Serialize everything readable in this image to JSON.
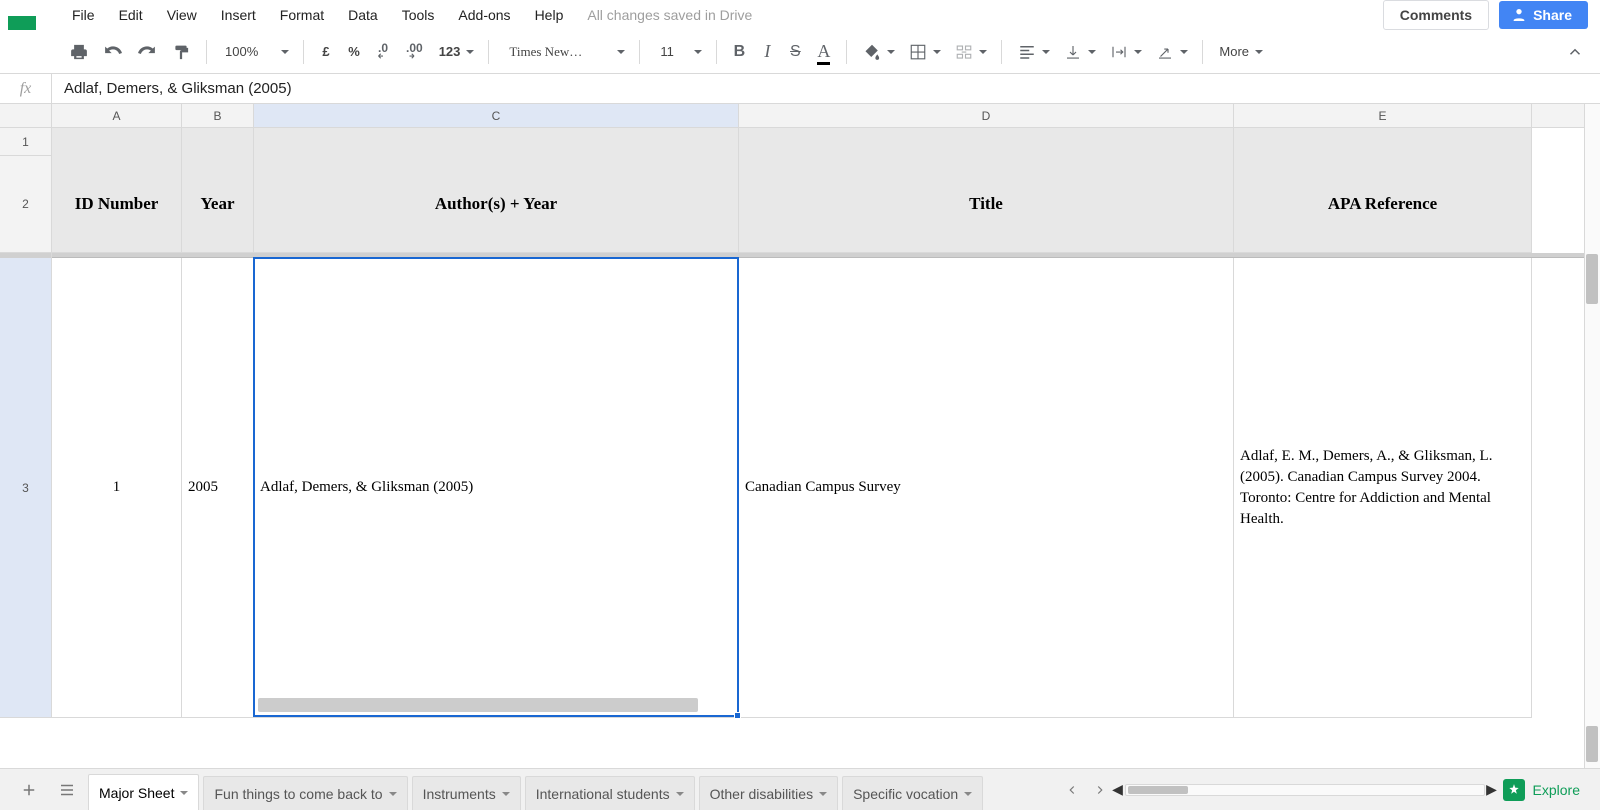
{
  "menus": [
    "File",
    "Edit",
    "View",
    "Insert",
    "Format",
    "Data",
    "Tools",
    "Add-ons",
    "Help"
  ],
  "status": "All changes saved in Drive",
  "comments_label": "Comments",
  "share_label": "Share",
  "toolbar": {
    "zoom": "100%",
    "currency_symbol": "£",
    "percent_symbol": "%",
    "dec_less": ".0",
    "dec_more": ".00",
    "num_format": "123",
    "font_family": "Times New…",
    "font_size": "11",
    "more_label": "More"
  },
  "formula_bar": {
    "fx": "fx",
    "value": "Adlaf, Demers, & Gliksman (2005)"
  },
  "columns": [
    {
      "id": "A",
      "width": "col-A"
    },
    {
      "id": "B",
      "width": "col-B"
    },
    {
      "id": "C",
      "width": "col-C"
    },
    {
      "id": "D",
      "width": "col-D"
    },
    {
      "id": "E",
      "width": "col-E"
    }
  ],
  "header_row_labels": {
    "A": "ID Number",
    "B": "Year",
    "C": "Author(s) + Year",
    "D": "Title",
    "E": "APA Reference"
  },
  "data_rows": [
    {
      "num": "3",
      "A": "1",
      "B": "2005",
      "C": "Adlaf, Demers, & Gliksman (2005)",
      "D": "Canadian Campus Survey",
      "E": "Adlaf, E. M., Demers, A., & Gliksman, L. (2005). Canadian Campus Survey 2004. Toronto: Centre for Addiction and Mental Health."
    }
  ],
  "sheet_tabs": [
    "Major Sheet",
    "Fun things to come back to",
    "Instruments",
    "International students",
    "Other disabilities",
    "Specific vocation"
  ],
  "active_tab_index": 0,
  "explore_label": "Explore",
  "selected_cell": "C3",
  "row_labels": {
    "r1": "1",
    "r2": "2"
  }
}
